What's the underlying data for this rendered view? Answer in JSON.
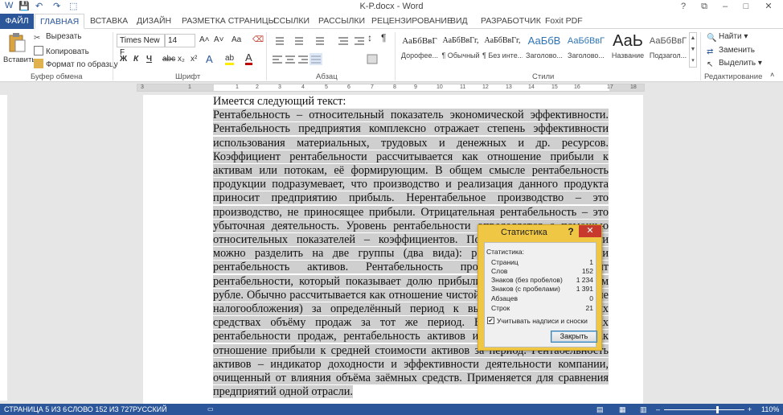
{
  "window": {
    "title": "K-P.docx - Word",
    "controls": [
      "?",
      "⧉",
      "–",
      "□",
      "✕"
    ]
  },
  "quick_access": [
    "W",
    "💾",
    "↶",
    "↷",
    "⬚"
  ],
  "tabs": [
    "ФАЙЛ",
    "ГЛАВНАЯ",
    "ВСТАВКА",
    "ДИЗАЙН",
    "РАЗМЕТКА СТРАНИЦЫ",
    "ССЫЛКИ",
    "РАССЫЛКИ",
    "РЕЦЕНЗИРОВАНИЕ",
    "ВИД",
    "РАЗРАБОТЧИК",
    "Foxit PDF"
  ],
  "ribbon": {
    "clipboard": {
      "paste": "Вставить",
      "cut": "Вырезать",
      "copy": "Копировать",
      "format_painter": "Формат по образцу",
      "group": "Буфер обмена"
    },
    "font": {
      "name": "Times New F",
      "size": "14",
      "group": "Шрифт",
      "bold": "Ж",
      "italic": "К",
      "underline": "Ч",
      "strike": "abc",
      "sub": "x₂",
      "sup": "x²",
      "grow": "A˄",
      "shrink": "A˅",
      "case": "Aa",
      "clear": "⌫"
    },
    "paragraph": {
      "group": "Абзац",
      "pilcrow": "¶",
      "sort": "↕"
    },
    "styles": {
      "group": "Стили",
      "items": [
        {
          "preview": "АаБбВвГ",
          "name": "Дорофее..."
        },
        {
          "preview": "АаБбВвГг,",
          "name": "¶ Обычный"
        },
        {
          "preview": "АаБбВвГг,",
          "name": "¶ Без инте..."
        },
        {
          "preview": "АаБбВ",
          "name": "Заголово..."
        },
        {
          "preview": "АаБбВвГ",
          "name": "Заголово..."
        },
        {
          "preview": "АаЬ",
          "name": "Название"
        },
        {
          "preview": "АаБбВвГ",
          "name": "Подзагол..."
        }
      ]
    },
    "editing": {
      "find": "Найти",
      "replace": "Заменить",
      "select": "Выделить",
      "group": "Редактирование"
    }
  },
  "ruler": [
    "3",
    "1",
    "1",
    "2",
    "3",
    "4",
    "5",
    "6",
    "7",
    "8",
    "9",
    "10",
    "11",
    "12",
    "13",
    "14",
    "15",
    "16",
    "17",
    "18"
  ],
  "document": {
    "intro": "Имеется следующий текст:",
    "paragraph": "Рентабельность – относительный показатель экономической эффективности. Рентабельность предприятия комплексно отражает степень эффективности использования материальных, трудовых и денежных и др. ресурсов. Коэффициент рентабельности рассчитывается как отношение прибыли к активам или потокам, её формирующим. В общем смысле рентабельность продукции подразумевает, что производство и реализация данного продукта приносит предприятию прибыль. Нерентабельное производство – это производство, не приносящее прибыли. Отрицательная рентабельность – это убыточная деятельность. Уровень рентабельности определяется с помощью относительных показателей – коэффициентов. Показатели рентабельности можно разделить на две группы (два вида): рентабельность продаж и рентабельность активов. Рентабельность продаж — коэффициент рентабельности, который показывает долю прибыли в каждом заработанном рубле. Обычно рассчитывается как отношение чистой прибыли (прибыли после налогообложения) за определённый период к выраженному в денежных средствах объёму продаж за тот же период. В англоязычных странах рентабельности продаж, рентабельность активов и т.д. Рассчитывается как отношение прибыли к средней стоимости активов за период. Рентабельность активов – индикатор доходности и эффективности деятельности компании, очищенный от влияния объёма заёмных средств. Применяется для сравнения предприятий одной отрасли."
  },
  "dialog": {
    "title": "Статистика",
    "help": "?",
    "close": "✕",
    "section": "Статистика:",
    "rows": [
      {
        "label": "Страниц",
        "value": "1"
      },
      {
        "label": "Слов",
        "value": "152"
      },
      {
        "label": "Знаков (без пробелов)",
        "value": "1 234"
      },
      {
        "label": "Знаков (с пробелами)",
        "value": "1 391"
      },
      {
        "label": "Абзацев",
        "value": "0"
      },
      {
        "label": "Строк",
        "value": "21"
      }
    ],
    "checkbox": "Учитывать надписи и сноски",
    "button": "Закрыть"
  },
  "status": {
    "page": "СТРАНИЦА 5 ИЗ 6",
    "words": "СЛОВО 152 ИЗ 727",
    "lang": "РУССКИЙ",
    "zoom": "110%",
    "zoom_minus": "–",
    "zoom_plus": "+"
  }
}
